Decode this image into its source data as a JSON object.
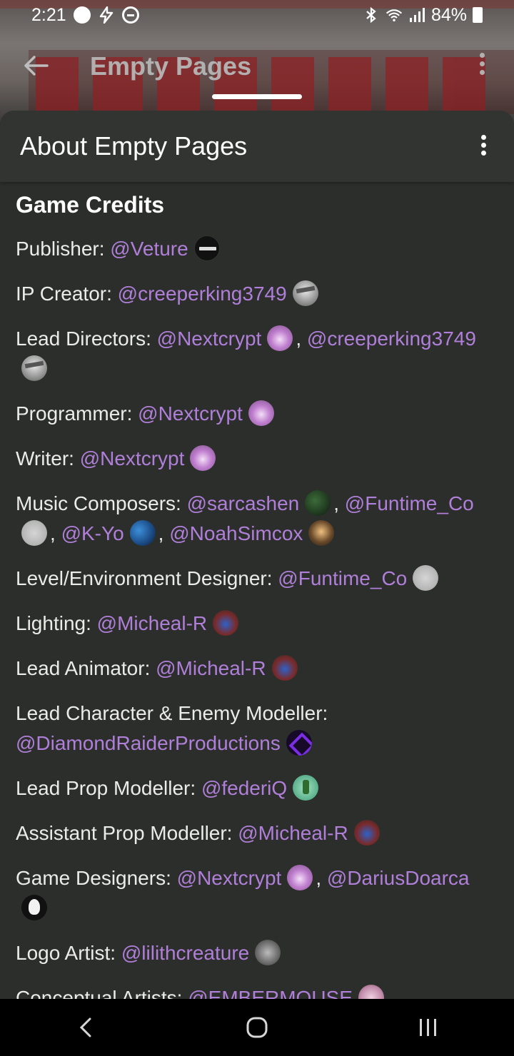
{
  "status_bar": {
    "time": "2:21",
    "battery": "84%"
  },
  "top_nav": {
    "title": "Empty Pages"
  },
  "sheet": {
    "title": "About Empty Pages",
    "section_title": "Game Credits",
    "credits": [
      {
        "role": "Publisher:",
        "mentions": [
          {
            "name": "@Veture",
            "avatar": "veture"
          }
        ]
      },
      {
        "role": "IP Creator:",
        "mentions": [
          {
            "name": "@creeperking3749",
            "avatar": "creeper"
          }
        ]
      },
      {
        "role": "Lead Directors:",
        "mentions": [
          {
            "name": "@Nextcrypt",
            "avatar": "next"
          },
          {
            "name": "@creeperking3749",
            "avatar": "creeper"
          }
        ]
      },
      {
        "role": "Programmer:",
        "mentions": [
          {
            "name": "@Nextcrypt",
            "avatar": "next"
          }
        ]
      },
      {
        "role": "Writer:",
        "mentions": [
          {
            "name": "@Nextcrypt",
            "avatar": "next"
          }
        ]
      },
      {
        "role": "Music Composers:",
        "mentions": [
          {
            "name": "@sarcashen",
            "avatar": "sarca"
          },
          {
            "name": "@Funtime_Co",
            "avatar": "funtime"
          },
          {
            "name": "@K-Yo",
            "avatar": "kyo"
          },
          {
            "name": "@NoahSimcox",
            "avatar": "noah"
          }
        ]
      },
      {
        "role": "Level/Environment Designer:",
        "mentions": [
          {
            "name": "@Funtime_Co",
            "avatar": "funtime"
          }
        ]
      },
      {
        "role": "Lighting:",
        "mentions": [
          {
            "name": "@Micheal-R",
            "avatar": "micheal"
          }
        ]
      },
      {
        "role": "Lead Animator:",
        "mentions": [
          {
            "name": "@Micheal-R",
            "avatar": "micheal"
          }
        ]
      },
      {
        "role": "Lead Character & Enemy Modeller:",
        "mentions": [
          {
            "name": "@DiamondRaiderProductions",
            "avatar": "diamond"
          }
        ]
      },
      {
        "role": "Lead Prop Modeller:",
        "mentions": [
          {
            "name": "@federiQ",
            "avatar": "federi"
          }
        ]
      },
      {
        "role": "Assistant Prop Modeller:",
        "mentions": [
          {
            "name": "@Micheal-R",
            "avatar": "micheal"
          }
        ]
      },
      {
        "role": "Game Designers:",
        "mentions": [
          {
            "name": "@Nextcrypt",
            "avatar": "next"
          },
          {
            "name": "@DariusDoarca",
            "avatar": "darius"
          }
        ]
      },
      {
        "role": "Logo Artist:",
        "mentions": [
          {
            "name": "@lilithcreature",
            "avatar": "lilith"
          }
        ]
      },
      {
        "role": "Conceptual Artists:",
        "mentions": [
          {
            "name": "@EMBERMOUSE",
            "avatar": "ember"
          }
        ]
      }
    ]
  },
  "colors": {
    "mention": "#b07fd9",
    "background": "#2c2e2b",
    "header": "#323431"
  },
  "icons": {
    "back": "back-arrow-icon",
    "menu": "kebab-menu-icon",
    "nav_back": "chevron-left-icon",
    "nav_home": "home-circle-icon",
    "nav_recents": "recents-bars-icon"
  }
}
